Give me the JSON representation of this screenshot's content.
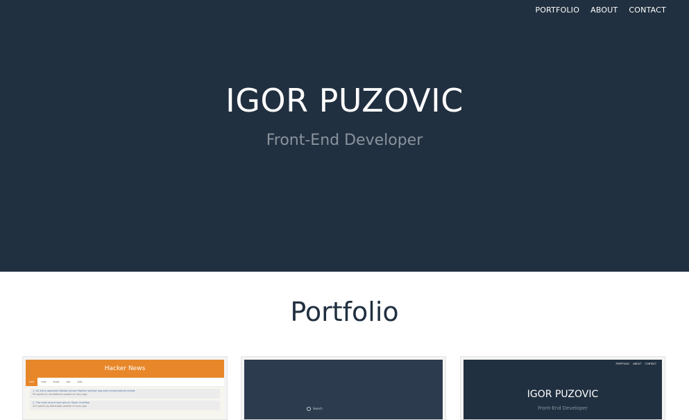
{
  "nav": {
    "items": [
      {
        "label": "PORTFOLIO"
      },
      {
        "label": "ABOUT"
      },
      {
        "label": "CONTACT"
      }
    ]
  },
  "hero": {
    "title": "IGOR PUZOVIC",
    "subtitle": "Front-End Developer"
  },
  "portfolio": {
    "heading": "Portfolio",
    "cards": [
      {
        "header": "Hacker News",
        "tabs": [
          "new",
          "new",
          "show",
          "ask",
          "jobs"
        ],
        "rows": [
          {
            "text": "1. US Army approves Dakota Access Pipeline without required environmental review",
            "meta": "99 points by unrealtoner posted an hour ago"
          },
          {
            "text": "2. The most recent tool sets on Stack Overflow",
            "meta": "297 points by ibelanator posted 4 hours ago"
          }
        ]
      },
      {
        "search_label": "Search"
      },
      {
        "nav": [
          "PORTFOLIO",
          "ABOUT",
          "CONTACT"
        ],
        "title": "IGOR PUZOVIC",
        "subtitle": "Front-End Developer"
      }
    ]
  },
  "colors": {
    "hero_bg": "#213040",
    "hn_orange": "#e8872a",
    "heading": "#213040",
    "subtitle": "#8a939d"
  }
}
